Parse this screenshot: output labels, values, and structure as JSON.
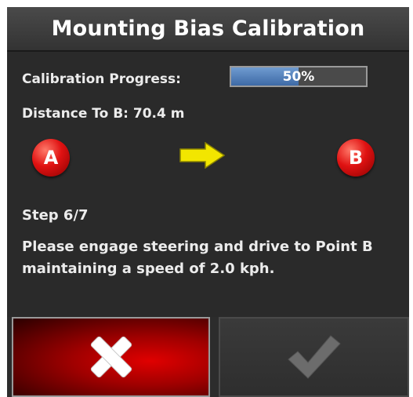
{
  "dialog": {
    "title": "Mounting Bias Calibration"
  },
  "calibration": {
    "progress_label": "Calibration Progress:",
    "progress_value": 0.5,
    "progress_text": "50%",
    "distance_label": "Distance To B: 70.4 m"
  },
  "route": {
    "point_a": "A",
    "point_b": "B",
    "arrow_icon": "right-arrow-icon",
    "arrow_color": "#f2e600",
    "marker_color": "#e01212"
  },
  "step": {
    "label": "Step 6/7",
    "instruction": "Please engage steering and drive to Point B maintaining a speed of 2.0 kph."
  },
  "buttons": {
    "cancel_icon": "close-icon",
    "confirm_icon": "check-icon",
    "confirm_enabled": false
  }
}
